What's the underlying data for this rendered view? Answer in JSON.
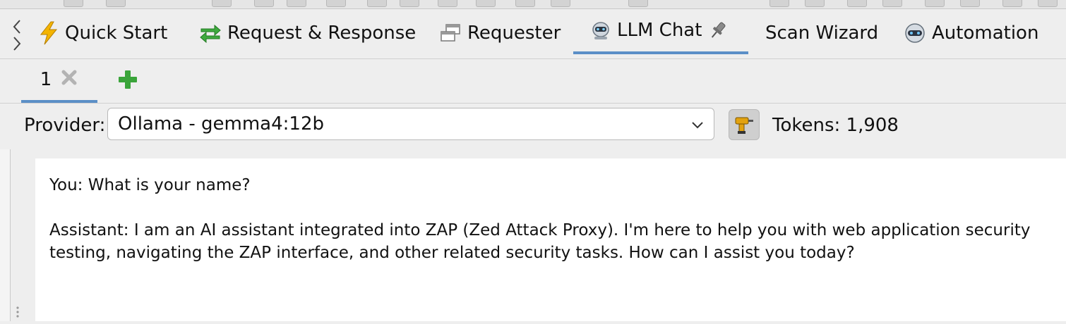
{
  "main_tabs": [
    {
      "label": "Quick Start",
      "icon": "lightning-icon"
    },
    {
      "label": "Request & Response",
      "icon": "swap-arrows-icon"
    },
    {
      "label": "Requester",
      "icon": "windows-icon"
    },
    {
      "label": "LLM Chat",
      "icon": "robot-icon",
      "active": true,
      "pinned": true
    },
    {
      "label": "Scan Wizard",
      "icon": ""
    },
    {
      "label": "Automation",
      "icon": "robot-helmet-icon"
    }
  ],
  "sub_tabs": [
    {
      "label": "1",
      "active": true
    }
  ],
  "provider": {
    "label": "Provider:",
    "selected": "Ollama - gemma4:12b"
  },
  "tokens": {
    "text": "Tokens: 1,908"
  },
  "chat": {
    "user_message": "You: What is your name?",
    "assistant_message": "Assistant: I am an AI assistant integrated into ZAP (Zed Attack Proxy). I'm here to help you with web application security testing, navigating the ZAP interface, and other related security tasks. How can I assist you today?"
  },
  "colors": {
    "active_tab_underline": "#5b8fc7",
    "background": "#eeeeee",
    "add_green": "#3aa43a"
  }
}
